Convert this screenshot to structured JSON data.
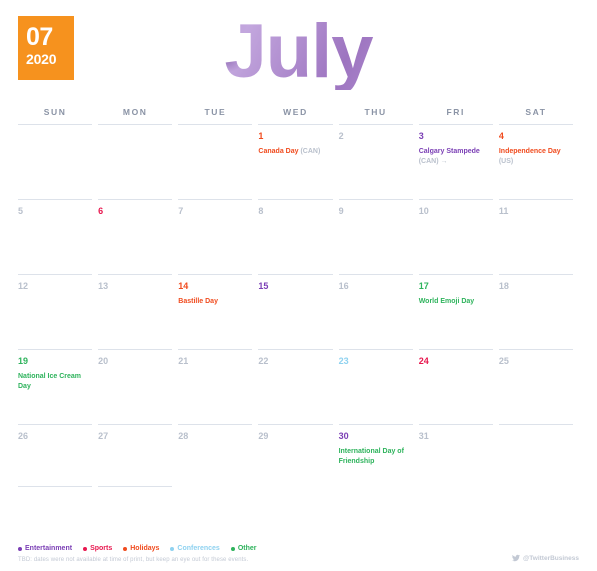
{
  "badge": {
    "month_number": "07",
    "year": "2020"
  },
  "title": "July",
  "weekdays": [
    "SUN",
    "MON",
    "TUE",
    "WED",
    "THU",
    "FRI",
    "SAT"
  ],
  "colors": {
    "entertainment": "#7b3fb5",
    "sports": "#e8174e",
    "holidays": "#f04b1e",
    "conferences": "#8fd2f0",
    "other": "#2eb35c",
    "badge_orange": "#f6921e",
    "title_purple": "#b08ed0",
    "muted": "#b9c0cc",
    "rule": "#dde2ea"
  },
  "weeks": [
    [
      {
        "num": "",
        "category": "",
        "events": []
      },
      {
        "num": "",
        "category": "",
        "events": []
      },
      {
        "num": "",
        "category": "",
        "events": []
      },
      {
        "num": "1",
        "category": "holidays",
        "events": [
          {
            "name": "Canada Day ",
            "region": "(CAN)",
            "category": "holidays"
          }
        ]
      },
      {
        "num": "2",
        "category": "",
        "events": []
      },
      {
        "num": "3",
        "category": "entertainment",
        "events": [
          {
            "name": "Calgary Stampede ",
            "region": "(CAN) →",
            "category": "entertainment"
          }
        ]
      },
      {
        "num": "4",
        "category": "holidays",
        "events": [
          {
            "name": "Independence Day ",
            "region": "(US)",
            "category": "holidays"
          }
        ]
      }
    ],
    [
      {
        "num": "5",
        "category": "",
        "events": []
      },
      {
        "num": "6",
        "category": "sports",
        "events": []
      },
      {
        "num": "7",
        "category": "",
        "events": []
      },
      {
        "num": "8",
        "category": "",
        "events": []
      },
      {
        "num": "9",
        "category": "",
        "events": []
      },
      {
        "num": "10",
        "category": "",
        "events": []
      },
      {
        "num": "11",
        "category": "",
        "events": []
      }
    ],
    [
      {
        "num": "12",
        "category": "",
        "events": []
      },
      {
        "num": "13",
        "category": "",
        "events": []
      },
      {
        "num": "14",
        "category": "holidays",
        "events": [
          {
            "name": "Bastille Day",
            "region": "",
            "category": "holidays"
          }
        ]
      },
      {
        "num": "15",
        "category": "entertainment",
        "events": []
      },
      {
        "num": "16",
        "category": "",
        "events": []
      },
      {
        "num": "17",
        "category": "other",
        "events": [
          {
            "name": "World Emoji Day",
            "region": "",
            "category": "other"
          }
        ]
      },
      {
        "num": "18",
        "category": "",
        "events": []
      }
    ],
    [
      {
        "num": "19",
        "category": "other",
        "events": [
          {
            "name": "National Ice Cream Day",
            "region": "",
            "category": "other"
          }
        ]
      },
      {
        "num": "20",
        "category": "",
        "events": []
      },
      {
        "num": "21",
        "category": "",
        "events": []
      },
      {
        "num": "22",
        "category": "",
        "events": []
      },
      {
        "num": "23",
        "category": "conferences",
        "events": []
      },
      {
        "num": "24",
        "category": "sports",
        "events": []
      },
      {
        "num": "25",
        "category": "",
        "events": []
      }
    ],
    [
      {
        "num": "26",
        "category": "",
        "events": []
      },
      {
        "num": "27",
        "category": "",
        "events": []
      },
      {
        "num": "28",
        "category": "",
        "events": []
      },
      {
        "num": "29",
        "category": "",
        "events": []
      },
      {
        "num": "30",
        "category": "entertainment",
        "events": [
          {
            "name": "International Day of Friendship",
            "region": "",
            "category": "other"
          }
        ]
      },
      {
        "num": "31",
        "category": "",
        "events": []
      },
      {
        "num": "",
        "category": "",
        "events": []
      }
    ]
  ],
  "final_row_rules": [
    true,
    true,
    false,
    false,
    false,
    false,
    false
  ],
  "legend": [
    {
      "label": "Entertainment",
      "color": "#7b3fb5"
    },
    {
      "label": "Sports",
      "color": "#e8174e"
    },
    {
      "label": "Holidays",
      "color": "#f04b1e"
    },
    {
      "label": "Conferences",
      "color": "#8fd2f0"
    },
    {
      "label": "Other",
      "color": "#2eb35c"
    }
  ],
  "footnote": "TBD: dates were not available at time of print, but keep an eye out for these events.",
  "branding": {
    "handle": "@TwitterBusiness",
    "icon": "twitter-bird-icon"
  }
}
